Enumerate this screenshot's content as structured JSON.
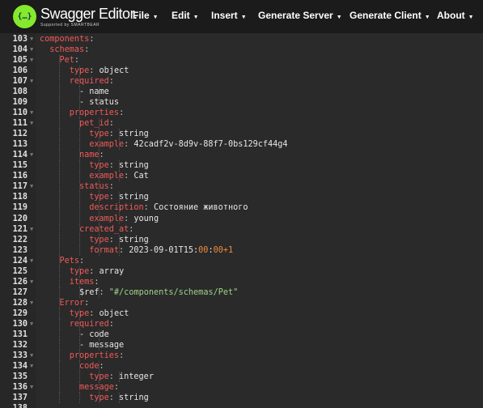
{
  "header": {
    "logo_glyph": "{…}",
    "app_title": "Swagger Editor.",
    "app_subtitle": "Supported by SMARTBEAR",
    "menu": [
      {
        "label": "File"
      },
      {
        "label": "Edit"
      },
      {
        "label": "Insert"
      },
      {
        "label": "Generate Server"
      },
      {
        "label": "Generate Client"
      },
      {
        "label": "About"
      }
    ],
    "caret": "▼"
  },
  "colors": {
    "key": "#f05a5a",
    "string": "#9fd28a",
    "number": "#f08c3c",
    "logo": "#85ea2d"
  },
  "editor": {
    "lines": [
      {
        "n": "103",
        "i": 0,
        "f": true,
        "t": [
          [
            "k",
            "components"
          ],
          [
            "p",
            ":"
          ]
        ]
      },
      {
        "n": "104",
        "i": 1,
        "f": true,
        "t": [
          [
            "k",
            "schemas"
          ],
          [
            "p",
            ":"
          ]
        ]
      },
      {
        "n": "105",
        "i": 2,
        "f": true,
        "t": [
          [
            "k",
            "Pet"
          ],
          [
            "p",
            ":"
          ]
        ]
      },
      {
        "n": "106",
        "i": 3,
        "f": false,
        "t": [
          [
            "k",
            "type"
          ],
          [
            "p",
            ": "
          ],
          [
            "v",
            "object"
          ]
        ]
      },
      {
        "n": "107",
        "i": 3,
        "f": true,
        "t": [
          [
            "k",
            "required"
          ],
          [
            "p",
            ":"
          ]
        ]
      },
      {
        "n": "108",
        "i": 4,
        "f": false,
        "t": [
          [
            "v",
            "- name"
          ]
        ]
      },
      {
        "n": "109",
        "i": 4,
        "f": false,
        "t": [
          [
            "v",
            "- status"
          ]
        ]
      },
      {
        "n": "110",
        "i": 3,
        "f": true,
        "t": [
          [
            "k",
            "properties"
          ],
          [
            "p",
            ":"
          ]
        ]
      },
      {
        "n": "111",
        "i": 4,
        "f": true,
        "t": [
          [
            "k",
            "pet_id"
          ],
          [
            "p",
            ":"
          ]
        ]
      },
      {
        "n": "112",
        "i": 5,
        "f": false,
        "t": [
          [
            "k",
            "type"
          ],
          [
            "p",
            ": "
          ],
          [
            "v",
            "string"
          ]
        ]
      },
      {
        "n": "113",
        "i": 5,
        "f": false,
        "t": [
          [
            "k",
            "example"
          ],
          [
            "p",
            ": "
          ],
          [
            "v",
            "42cadf2v-8d9v-88f7-0bs129cf44g4"
          ]
        ]
      },
      {
        "n": "114",
        "i": 4,
        "f": true,
        "t": [
          [
            "k",
            "name"
          ],
          [
            "p",
            ":"
          ]
        ]
      },
      {
        "n": "115",
        "i": 5,
        "f": false,
        "t": [
          [
            "k",
            "type"
          ],
          [
            "p",
            ": "
          ],
          [
            "v",
            "string"
          ]
        ]
      },
      {
        "n": "116",
        "i": 5,
        "f": false,
        "t": [
          [
            "k",
            "example"
          ],
          [
            "p",
            ": "
          ],
          [
            "v",
            "Cat"
          ]
        ]
      },
      {
        "n": "117",
        "i": 4,
        "f": true,
        "t": [
          [
            "k",
            "status"
          ],
          [
            "p",
            ":"
          ]
        ]
      },
      {
        "n": "118",
        "i": 5,
        "f": false,
        "t": [
          [
            "k",
            "type"
          ],
          [
            "p",
            ": "
          ],
          [
            "v",
            "string"
          ]
        ]
      },
      {
        "n": "119",
        "i": 5,
        "f": false,
        "t": [
          [
            "k",
            "description"
          ],
          [
            "p",
            ": "
          ],
          [
            "v",
            "Состояние животного"
          ]
        ]
      },
      {
        "n": "120",
        "i": 5,
        "f": false,
        "t": [
          [
            "k",
            "example"
          ],
          [
            "p",
            ": "
          ],
          [
            "v",
            "young"
          ]
        ]
      },
      {
        "n": "121",
        "i": 4,
        "f": true,
        "t": [
          [
            "k",
            "created_at"
          ],
          [
            "p",
            ":"
          ]
        ]
      },
      {
        "n": "122",
        "i": 5,
        "f": false,
        "t": [
          [
            "k",
            "type"
          ],
          [
            "p",
            ": "
          ],
          [
            "v",
            "string"
          ]
        ]
      },
      {
        "n": "123",
        "i": 5,
        "f": false,
        "t": [
          [
            "k",
            "format"
          ],
          [
            "p",
            ": "
          ],
          [
            "v",
            "2023-09-01T15:"
          ],
          [
            "o",
            "00"
          ],
          [
            "v",
            ":"
          ],
          [
            "o",
            "00+1"
          ]
        ]
      },
      {
        "n": "124",
        "i": 2,
        "f": true,
        "t": [
          [
            "k",
            "Pets"
          ],
          [
            "p",
            ":"
          ]
        ]
      },
      {
        "n": "125",
        "i": 3,
        "f": false,
        "t": [
          [
            "k",
            "type"
          ],
          [
            "p",
            ": "
          ],
          [
            "v",
            "array"
          ]
        ]
      },
      {
        "n": "126",
        "i": 3,
        "f": true,
        "t": [
          [
            "k",
            "items"
          ],
          [
            "p",
            ":"
          ]
        ]
      },
      {
        "n": "127",
        "i": 4,
        "f": false,
        "t": [
          [
            "v",
            "$ref"
          ],
          [
            "p",
            ": "
          ],
          [
            "s",
            "\"#/components/schemas/Pet\""
          ]
        ]
      },
      {
        "n": "128",
        "i": 2,
        "f": true,
        "t": [
          [
            "k",
            "Error"
          ],
          [
            "p",
            ":"
          ]
        ]
      },
      {
        "n": "129",
        "i": 3,
        "f": false,
        "t": [
          [
            "k",
            "type"
          ],
          [
            "p",
            ": "
          ],
          [
            "v",
            "object"
          ]
        ]
      },
      {
        "n": "130",
        "i": 3,
        "f": true,
        "t": [
          [
            "k",
            "required"
          ],
          [
            "p",
            ":"
          ]
        ]
      },
      {
        "n": "131",
        "i": 4,
        "f": false,
        "t": [
          [
            "v",
            "- code"
          ]
        ]
      },
      {
        "n": "132",
        "i": 4,
        "f": false,
        "t": [
          [
            "v",
            "- message"
          ]
        ]
      },
      {
        "n": "133",
        "i": 3,
        "f": true,
        "t": [
          [
            "k",
            "properties"
          ],
          [
            "p",
            ":"
          ]
        ]
      },
      {
        "n": "134",
        "i": 4,
        "f": true,
        "t": [
          [
            "k",
            "code"
          ],
          [
            "p",
            ":"
          ]
        ]
      },
      {
        "n": "135",
        "i": 5,
        "f": false,
        "t": [
          [
            "k",
            "type"
          ],
          [
            "p",
            ": "
          ],
          [
            "v",
            "integer"
          ]
        ]
      },
      {
        "n": "136",
        "i": 4,
        "f": true,
        "t": [
          [
            "k",
            "message"
          ],
          [
            "p",
            ":"
          ]
        ]
      },
      {
        "n": "137",
        "i": 5,
        "f": false,
        "t": [
          [
            "k",
            "type"
          ],
          [
            "p",
            ": "
          ],
          [
            "v",
            "string"
          ]
        ]
      },
      {
        "n": "138",
        "i": 0,
        "f": false,
        "t": []
      }
    ]
  }
}
